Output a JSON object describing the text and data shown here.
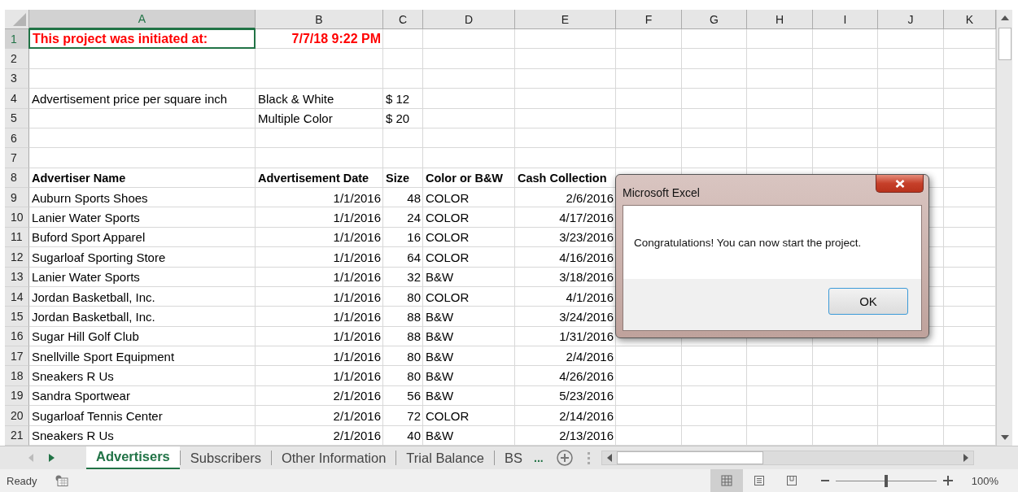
{
  "workbook": {
    "columns": [
      {
        "label": "A",
        "selected": true
      },
      {
        "label": "B",
        "selected": false
      },
      {
        "label": "C",
        "selected": false
      },
      {
        "label": "D",
        "selected": false
      },
      {
        "label": "E",
        "selected": false
      },
      {
        "label": "F",
        "selected": false
      },
      {
        "label": "G",
        "selected": false
      },
      {
        "label": "H",
        "selected": false
      },
      {
        "label": "I",
        "selected": false
      },
      {
        "label": "J",
        "selected": false
      },
      {
        "label": "K",
        "selected": false
      }
    ],
    "rows": [
      {
        "number": "1",
        "selected": true,
        "cells": [
          {
            "text": "This project was initiated at:",
            "kind": "alert"
          },
          {
            "text": "7/7/18 9:22 PM",
            "kind": "alert-number"
          }
        ]
      },
      {
        "number": "2",
        "selected": false
      },
      {
        "number": "3",
        "selected": false
      },
      {
        "number": "4",
        "selected": false,
        "cells": [
          {
            "text": "Advertisement price per square inch",
            "kind": "text"
          },
          {
            "text": "Black & White",
            "kind": "text"
          },
          {
            "text": "$ 12",
            "kind": "text"
          }
        ]
      },
      {
        "number": "5",
        "selected": false,
        "cells": [
          null,
          {
            "text": "Multiple Color",
            "kind": "text"
          },
          {
            "text": "$ 20",
            "kind": "text"
          }
        ]
      },
      {
        "number": "6",
        "selected": false
      },
      {
        "number": "7",
        "selected": false
      },
      {
        "number": "8",
        "selected": false,
        "cells": [
          {
            "text": "Advertiser Name",
            "kind": "header"
          },
          {
            "text": "Advertisement Date",
            "kind": "header"
          },
          {
            "text": "Size",
            "kind": "header"
          },
          {
            "text": "Color or B&W",
            "kind": "header"
          },
          {
            "text": "Cash Collection",
            "kind": "header"
          }
        ]
      },
      {
        "number": "9",
        "selected": false,
        "cells": [
          {
            "text": "Auburn Sports Shoes",
            "kind": "text"
          },
          {
            "text": "1/1/2016",
            "kind": "number"
          },
          {
            "text": "48",
            "kind": "number"
          },
          {
            "text": "COLOR",
            "kind": "text"
          },
          {
            "text": "2/6/2016",
            "kind": "number"
          }
        ]
      },
      {
        "number": "10",
        "selected": false,
        "cells": [
          {
            "text": "Lanier Water Sports",
            "kind": "text"
          },
          {
            "text": "1/1/2016",
            "kind": "number"
          },
          {
            "text": "24",
            "kind": "number"
          },
          {
            "text": "COLOR",
            "kind": "text"
          },
          {
            "text": "4/17/2016",
            "kind": "number"
          }
        ]
      },
      {
        "number": "11",
        "selected": false,
        "cells": [
          {
            "text": "Buford Sport Apparel",
            "kind": "text"
          },
          {
            "text": "1/1/2016",
            "kind": "number"
          },
          {
            "text": "16",
            "kind": "number"
          },
          {
            "text": "COLOR",
            "kind": "text"
          },
          {
            "text": "3/23/2016",
            "kind": "number"
          }
        ]
      },
      {
        "number": "12",
        "selected": false,
        "cells": [
          {
            "text": "Sugarloaf Sporting Store",
            "kind": "text"
          },
          {
            "text": "1/1/2016",
            "kind": "number"
          },
          {
            "text": "64",
            "kind": "number"
          },
          {
            "text": "COLOR",
            "kind": "text"
          },
          {
            "text": "4/16/2016",
            "kind": "number"
          }
        ]
      },
      {
        "number": "13",
        "selected": false,
        "cells": [
          {
            "text": "Lanier Water Sports",
            "kind": "text"
          },
          {
            "text": "1/1/2016",
            "kind": "number"
          },
          {
            "text": "32",
            "kind": "number"
          },
          {
            "text": "B&W",
            "kind": "text"
          },
          {
            "text": "3/18/2016",
            "kind": "number"
          }
        ]
      },
      {
        "number": "14",
        "selected": false,
        "cells": [
          {
            "text": "Jordan Basketball, Inc.",
            "kind": "text"
          },
          {
            "text": "1/1/2016",
            "kind": "number"
          },
          {
            "text": "80",
            "kind": "number"
          },
          {
            "text": "COLOR",
            "kind": "text"
          },
          {
            "text": "4/1/2016",
            "kind": "number"
          }
        ]
      },
      {
        "number": "15",
        "selected": false,
        "cells": [
          {
            "text": "Jordan Basketball, Inc.",
            "kind": "text"
          },
          {
            "text": "1/1/2016",
            "kind": "number"
          },
          {
            "text": "88",
            "kind": "number"
          },
          {
            "text": "B&W",
            "kind": "text"
          },
          {
            "text": "3/24/2016",
            "kind": "number"
          }
        ]
      },
      {
        "number": "16",
        "selected": false,
        "cells": [
          {
            "text": "Sugar Hill Golf Club",
            "kind": "text"
          },
          {
            "text": "1/1/2016",
            "kind": "number"
          },
          {
            "text": "88",
            "kind": "number"
          },
          {
            "text": "B&W",
            "kind": "text"
          },
          {
            "text": "1/31/2016",
            "kind": "number"
          }
        ]
      },
      {
        "number": "17",
        "selected": false,
        "cells": [
          {
            "text": "Snellville Sport Equipment",
            "kind": "text"
          },
          {
            "text": "1/1/2016",
            "kind": "number"
          },
          {
            "text": "80",
            "kind": "number"
          },
          {
            "text": "B&W",
            "kind": "text"
          },
          {
            "text": "2/4/2016",
            "kind": "number"
          }
        ]
      },
      {
        "number": "18",
        "selected": false,
        "cells": [
          {
            "text": "Sneakers R Us",
            "kind": "text"
          },
          {
            "text": "1/1/2016",
            "kind": "number"
          },
          {
            "text": "80",
            "kind": "number"
          },
          {
            "text": "B&W",
            "kind": "text"
          },
          {
            "text": "4/26/2016",
            "kind": "number"
          }
        ]
      },
      {
        "number": "19",
        "selected": false,
        "cells": [
          {
            "text": "Sandra Sportwear",
            "kind": "text"
          },
          {
            "text": "2/1/2016",
            "kind": "number"
          },
          {
            "text": "56",
            "kind": "number"
          },
          {
            "text": "B&W",
            "kind": "text"
          },
          {
            "text": "5/23/2016",
            "kind": "number"
          }
        ]
      },
      {
        "number": "20",
        "selected": false,
        "cells": [
          {
            "text": "Sugarloaf Tennis Center",
            "kind": "text"
          },
          {
            "text": "2/1/2016",
            "kind": "number"
          },
          {
            "text": "72",
            "kind": "number"
          },
          {
            "text": "COLOR",
            "kind": "text"
          },
          {
            "text": "2/14/2016",
            "kind": "number"
          }
        ]
      },
      {
        "number": "21",
        "selected": false,
        "cells": [
          {
            "text": "Sneakers R Us",
            "kind": "text"
          },
          {
            "text": "2/1/2016",
            "kind": "number"
          },
          {
            "text": "40",
            "kind": "number"
          },
          {
            "text": "B&W",
            "kind": "text"
          },
          {
            "text": "2/13/2016",
            "kind": "number"
          }
        ]
      }
    ]
  },
  "sheet_tabs": [
    {
      "label": "Advertisers",
      "selected": true
    },
    {
      "label": "Subscribers",
      "selected": false
    },
    {
      "label": "Other Information",
      "selected": false
    },
    {
      "label": "Trial Balance",
      "selected": false
    },
    {
      "label": "BS",
      "selected": false
    }
  ],
  "more_tabs": "...",
  "status_bar": {
    "status": "Ready",
    "views": [
      {
        "kind": "normal",
        "selected": true
      },
      {
        "kind": "page-layout",
        "selected": false
      },
      {
        "kind": "page-break",
        "selected": false
      }
    ],
    "zoom": {
      "level": 0.5
    },
    "zoom_reading": "100%"
  },
  "dialog": {
    "title": "Microsoft Excel",
    "message": "Congratulations! You can now start the project.",
    "buttons": [
      "OK"
    ]
  }
}
